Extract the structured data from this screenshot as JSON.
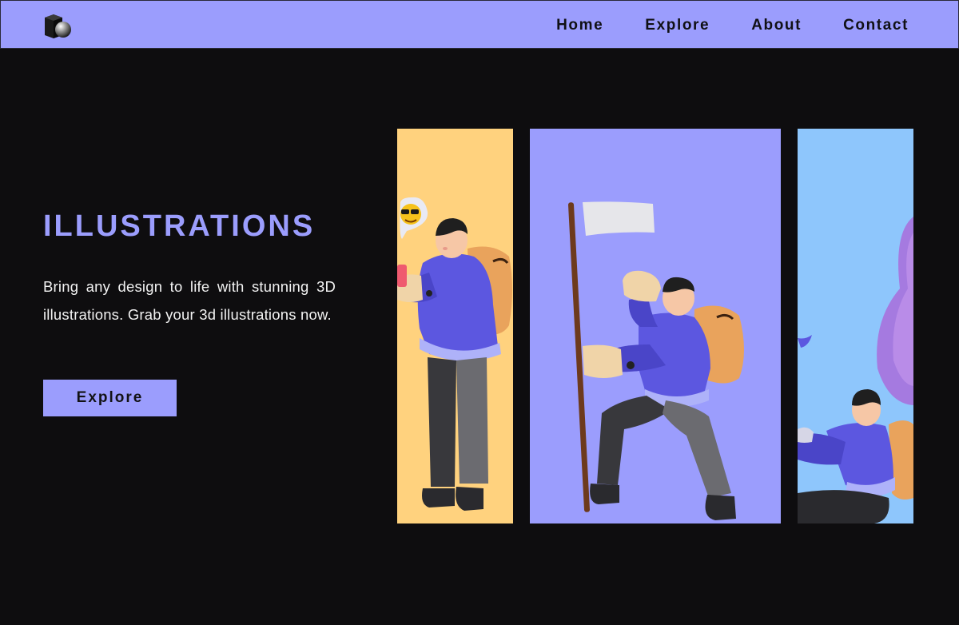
{
  "nav": {
    "logo_name": "cube-sphere-logo",
    "links": [
      "Home",
      "Explore",
      "About",
      "Contact"
    ]
  },
  "hero": {
    "title": "ILLUSTRATIONS",
    "description": "Bring any design to life with stunning 3D illustrations. Grab your 3d illustrations now.",
    "button_label": "Explore"
  },
  "gallery": {
    "cards": [
      {
        "subject": "character-with-phone-and-sunglasses-emoji",
        "background": "#ffd27e"
      },
      {
        "subject": "character-kneeling-with-white-flag",
        "background": "#9b9dfd"
      },
      {
        "subject": "character-sitting-with-laptop",
        "background": "#8ec6fc"
      }
    ]
  },
  "colors": {
    "accent": "#9b9dfd",
    "background": "#0e0d0f",
    "card_yellow": "#ffd27e",
    "card_blue": "#8ec6fc"
  }
}
